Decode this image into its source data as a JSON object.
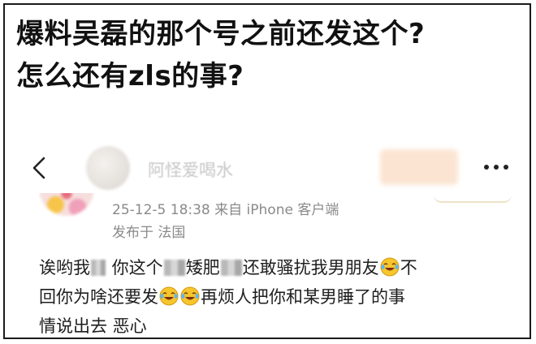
{
  "headline": {
    "line1": "爆料吴磊的那个号之前还发这个?",
    "line2": "怎么还有zls的事?"
  },
  "post": {
    "username": "阿怪爱喝水",
    "meta": {
      "datetime": "25-12-5 18:38",
      "source": "来自 iPhone 客户端",
      "published_in": "发布于 法国"
    },
    "content": {
      "l1_a": "诶哟我",
      "l1_b": " 你这个",
      "l1_c": "矮肥",
      "l1_d": "还敢骚扰我男朋友",
      "l1_e": "不",
      "l2_a": "回你为啥还要发",
      "l2_b": "再烦人把你和某男睡了的事",
      "l3": "情说出去 恶心"
    },
    "icons": {
      "back": "chevron-left-icon",
      "more": "more-horizontal-icon",
      "emoji": "laugh-cry-emoji-icon"
    }
  }
}
